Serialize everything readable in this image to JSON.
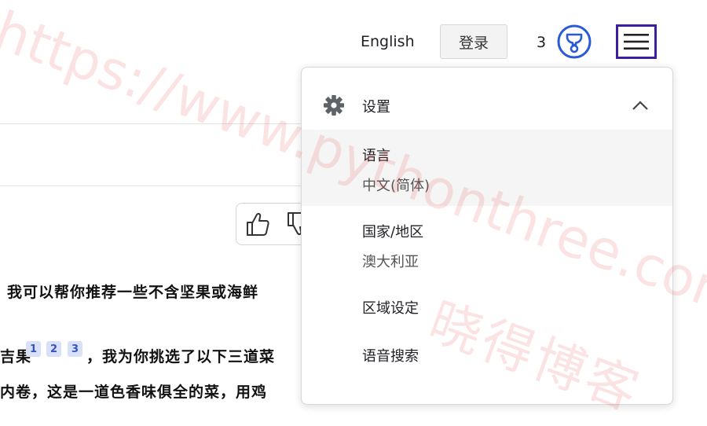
{
  "header": {
    "language_link": "English",
    "signin_label": "登录",
    "rewards_count": "3",
    "rewards_icon": "trophy-icon",
    "menu_icon": "hamburger-icon"
  },
  "menu": {
    "settings": {
      "label": "设置",
      "icon": "gear-icon",
      "expanded_icon": "chevron-up-icon"
    },
    "items": [
      {
        "title": "语言",
        "value": "中文(简体)",
        "selected": true
      },
      {
        "title": "国家/地区",
        "value": "澳大利亚"
      },
      {
        "title": "区域设定"
      },
      {
        "title": "语音搜索"
      }
    ]
  },
  "body": {
    "line1": "我可以帮你推荐一些不含坚果或海鲜",
    "line2_pre": "吉果",
    "citations": [
      "1",
      "2",
      "3"
    ],
    "line2_post": "，我为你挑选了以下三道菜",
    "line3": "内卷，这是一道色香味俱全的菜，用鸡"
  },
  "feedback": {
    "like_icon": "thumbs-up-icon",
    "dislike_icon": "thumbs-down-icon"
  },
  "watermark": {
    "url": "https://www.pythonthree.com",
    "site_name": "晓得博客"
  },
  "colors": {
    "menu_border": "#3c1f9e",
    "trophy": "#2a5bd7",
    "citation_bg": "#d8e1f9",
    "citation_text": "#3654b8"
  }
}
